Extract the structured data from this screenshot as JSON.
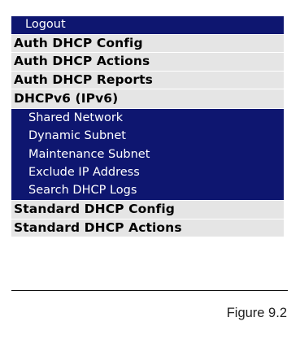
{
  "menu": {
    "logout": "Logout",
    "auth_dhcp_config": "Auth DHCP Config",
    "auth_dhcp_actions": "Auth DHCP Actions",
    "auth_dhcp_reports": "Auth DHCP Reports",
    "dhcpv6": "DHCPv6 (IPv6)",
    "sub_items": [
      {
        "label": "Shared Network"
      },
      {
        "label": "Dynamic Subnet"
      },
      {
        "label": "Maintenance Subnet"
      },
      {
        "label": "Exclude IP Address"
      },
      {
        "label": "Search DHCP Logs"
      }
    ],
    "standard_dhcp_config": "Standard DHCP Config",
    "standard_dhcp_actions": "Standard DHCP Actions"
  },
  "caption": "Figure 9.2",
  "colors": {
    "menu_dark": "#0e1670",
    "menu_light": "#e5e5e5"
  }
}
